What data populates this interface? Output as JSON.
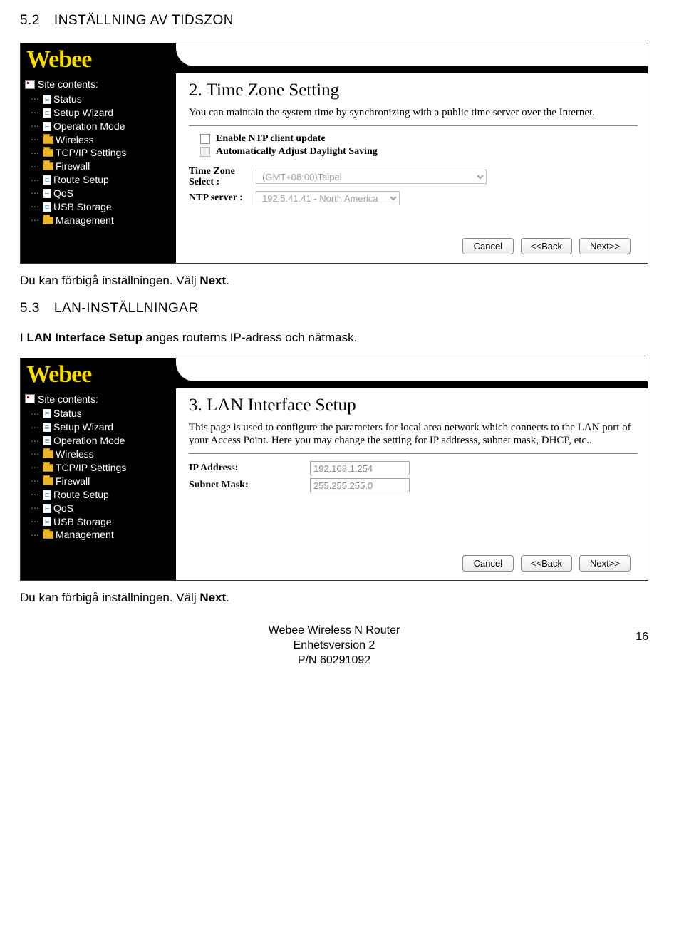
{
  "section52": {
    "num": "5.2",
    "title": "INSTÄLLNING AV TIDSZON"
  },
  "section53": {
    "num": "5.3",
    "title": "LAN-INSTÄLLNINGAR"
  },
  "para1_pre": "Du kan förbigå inställningen. Välj ",
  "para1_bold": "Next",
  "para1_post": ".",
  "para2_pre": "I ",
  "para2_bold": "LAN Interface Setup",
  "para2_post": " anges routerns IP-adress och nätmask.",
  "logo": "Webee",
  "sidebar": {
    "header": "Site contents:",
    "items": [
      {
        "label": "Status",
        "icon": "page"
      },
      {
        "label": "Setup Wizard",
        "icon": "page"
      },
      {
        "label": "Operation Mode",
        "icon": "page"
      },
      {
        "label": "Wireless",
        "icon": "folder"
      },
      {
        "label": "TCP/IP Settings",
        "icon": "folder"
      },
      {
        "label": "Firewall",
        "icon": "folder"
      },
      {
        "label": "Route Setup",
        "icon": "page"
      },
      {
        "label": "QoS",
        "icon": "page"
      },
      {
        "label": "USB Storage",
        "icon": "page"
      },
      {
        "label": "Management",
        "icon": "folder"
      }
    ]
  },
  "panel1": {
    "title": "2. Time Zone Setting",
    "desc": "You can maintain the system time by synchronizing with a public time server over the Internet.",
    "chk1": "Enable NTP client update",
    "chk2": "Automatically Adjust Daylight Saving",
    "tz_label": "Time Zone Select :",
    "tz_value": "(GMT+08:00)Taipei",
    "ntp_label": "NTP server :",
    "ntp_value": "192.5.41.41 - North America"
  },
  "panel2": {
    "title": "3. LAN Interface Setup",
    "desc": "This page is used to configure the parameters for local area network which connects to the LAN port of your Access Point. Here you may change the setting for IP addresss, subnet mask, DHCP, etc..",
    "ip_label": "IP Address:",
    "ip_value": "192.168.1.254",
    "mask_label": "Subnet Mask:",
    "mask_value": "255.255.255.0"
  },
  "buttons": {
    "cancel": "Cancel",
    "back": "<<Back",
    "next": "Next>>"
  },
  "footer": {
    "l1": "Webee Wireless N Router",
    "l2": "Enhetsversion 2",
    "l3": "P/N 60291092",
    "page": "16"
  }
}
